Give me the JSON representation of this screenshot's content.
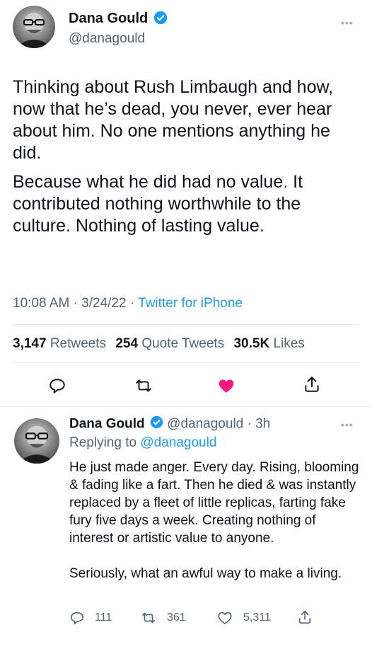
{
  "main_tweet": {
    "author_name": "Dana Gould",
    "handle": "@danagould",
    "more_glyph": "•••",
    "paragraphs": [
      "Thinking about Rush Limbaugh and how, now that he’s dead, you never, ever hear about him. No one mentions anything he did.",
      "Because what he did had no value. It contributed nothing worthwhile to the culture. Nothing of lasting value."
    ],
    "time": "10:08 AM",
    "date": "3/24/22",
    "separator": " · ",
    "source": "Twitter for iPhone",
    "stats": {
      "retweets_count": "3,147",
      "retweets_label": "Retweets",
      "quotes_count": "254",
      "quotes_label": "Quote Tweets",
      "likes_count": "30.5K",
      "likes_label": "Likes"
    },
    "actions": [
      "reply-icon",
      "retweet-icon",
      "like-icon",
      "share-icon"
    ],
    "liked": true,
    "like_color": "#f91880"
  },
  "reply_tweet": {
    "author_name": "Dana Gould",
    "handle_time": "@danagould · 3h",
    "replying_prefix": "Replying to ",
    "replying_handle": "@danagould",
    "more_glyph": "•••",
    "paragraphs": [
      "He just made anger. Every day. Rising, blooming & fading like a fart. Then he died & was instantly replaced by a fleet of little replicas, farting fake fury five days a week. Creating nothing of interest or artistic value to anyone.",
      "Seriously, what an awful way to make a living."
    ],
    "counts": {
      "replies": "111",
      "retweets": "361",
      "likes": "5,311"
    }
  },
  "colors": {
    "accent": "#1d9bf0",
    "text": "#0f1419",
    "muted": "#536471",
    "divider": "#e6ecf0"
  }
}
